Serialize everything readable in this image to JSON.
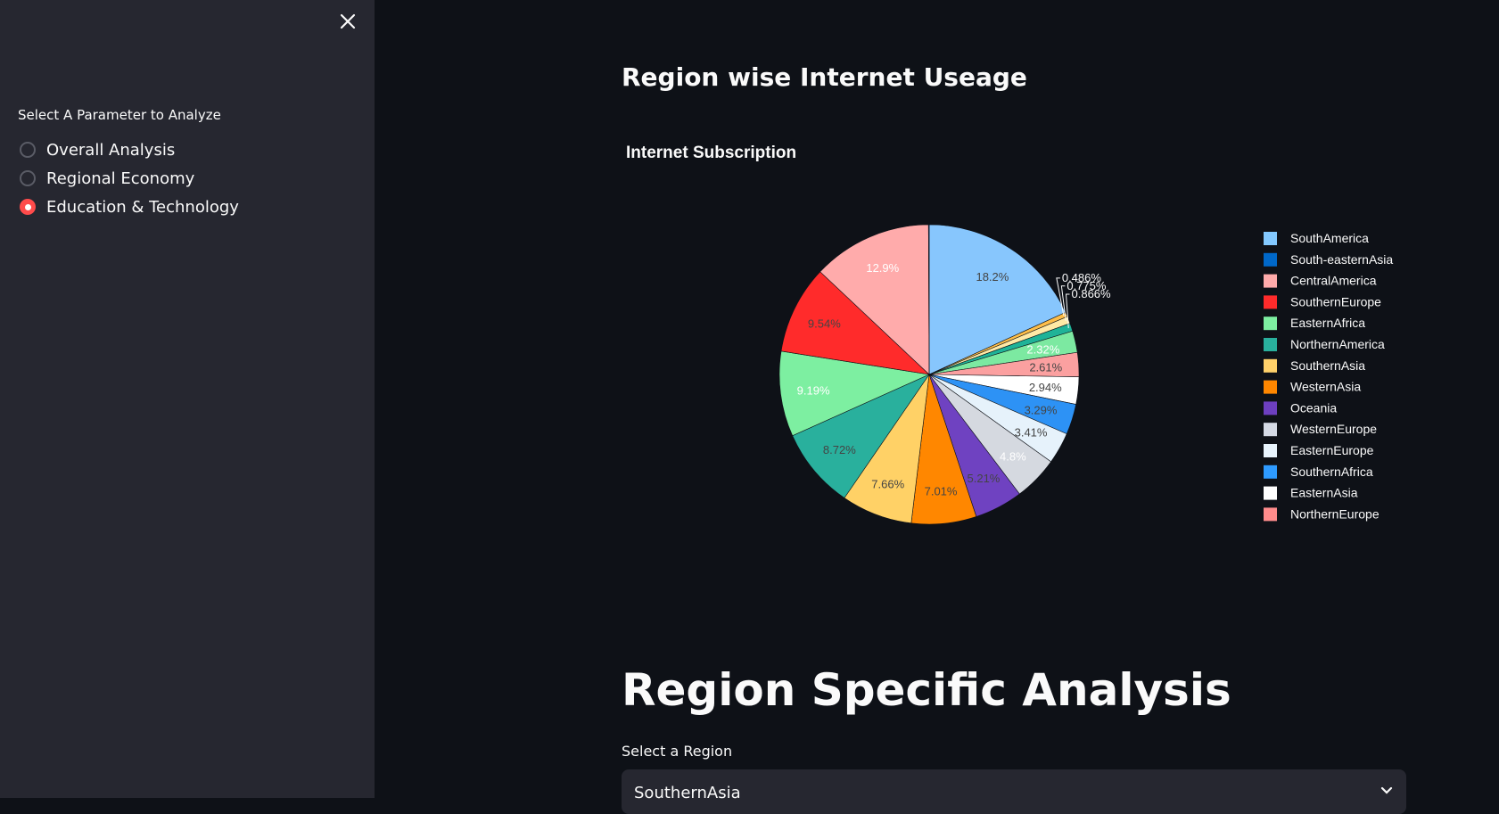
{
  "sidebar": {
    "radio_label": "Select A Parameter to Analyze",
    "options": [
      "Overall Analysis",
      "Regional Economy",
      "Education & Technology"
    ],
    "selected": "Education & Technology"
  },
  "main": {
    "section_title": "Region wise Internet Useage",
    "region_section_title": "Region Specific Analysis",
    "select_label": "Select a Region",
    "select_value": "SouthernAsia"
  },
  "chart_data": {
    "type": "pie",
    "title": "Internet Subscription",
    "legend_position": "right",
    "slices": [
      {
        "label": "SouthAmerica",
        "percent": 18.2,
        "text": "18.2%",
        "color": "#87c6fd",
        "text_color": "#444444"
      },
      {
        "label": "NorthernEurope",
        "percent": 0.486,
        "text": "0.486%",
        "color": "#fdbe4a",
        "text_color": "#ffffff"
      },
      {
        "label": "NorthernEurope",
        "percent": 0.775,
        "text": "0.775%",
        "color": "#ffe9a6",
        "text_color": "#ffffff"
      },
      {
        "label": "NorthernEurope",
        "percent": 0.866,
        "text": "0.866%",
        "color": "#1fb398",
        "text_color": "#ffffff"
      },
      {
        "label": "NorthernEurope",
        "percent": 2.32,
        "text": "2.32%",
        "color": "#7ce9a1",
        "text_color": "#ffffff"
      },
      {
        "label": "NorthernEurope",
        "percent": 2.61,
        "text": "2.61%",
        "color": "#fba0a0",
        "text_color": "#444444"
      },
      {
        "label": "EasternAsia",
        "percent": 2.94,
        "text": "2.94%",
        "color": "#ffffff",
        "text_color": "#444444"
      },
      {
        "label": "SouthernAfrica",
        "percent": 3.29,
        "text": "3.29%",
        "color": "#2d92f5",
        "text_color": "#444444"
      },
      {
        "label": "EasternEurope",
        "percent": 3.41,
        "text": "3.41%",
        "color": "#e6f2fb",
        "text_color": "#444444"
      },
      {
        "label": "WesternEurope",
        "percent": 4.8,
        "text": "4.8%",
        "color": "#d5d9e0",
        "text_color": "#ffffff"
      },
      {
        "label": "Oceania",
        "percent": 5.21,
        "text": "5.21%",
        "color": "#6f42c1",
        "text_color": "#444444"
      },
      {
        "label": "WesternAsia",
        "percent": 7.01,
        "text": "7.01%",
        "color": "#ff8700",
        "text_color": "#444444"
      },
      {
        "label": "SouthernAsia",
        "percent": 7.66,
        "text": "7.66%",
        "color": "#ffd166",
        "text_color": "#444444"
      },
      {
        "label": "NorthernAmerica",
        "percent": 8.72,
        "text": "8.72%",
        "color": "#29b09d",
        "text_color": "#444444"
      },
      {
        "label": "EasternAfrica",
        "percent": 9.19,
        "text": "9.19%",
        "color": "#7defa1",
        "text_color": "#ffffff"
      },
      {
        "label": "SouthernEurope",
        "percent": 9.54,
        "text": "9.54%",
        "color": "#ff2b2b",
        "text_color": "#444444"
      },
      {
        "label": "CentralAmerica",
        "percent": 12.9,
        "text": "12.9%",
        "color": "#ffabab",
        "text_color": "#ffffff"
      },
      {
        "label": "South-easternAsia",
        "percent": 0,
        "text": "",
        "color": "#0068c9",
        "text_color": "#ffffff"
      }
    ],
    "legend": [
      {
        "label": "SouthAmerica",
        "color": "#83c9ff"
      },
      {
        "label": "South-easternAsia",
        "color": "#0068c9"
      },
      {
        "label": "CentralAmerica",
        "color": "#ffabab"
      },
      {
        "label": "SouthernEurope",
        "color": "#ff2b2b"
      },
      {
        "label": "EasternAfrica",
        "color": "#7defa1"
      },
      {
        "label": "NorthernAmerica",
        "color": "#29b09d"
      },
      {
        "label": "SouthernAsia",
        "color": "#ffd16a"
      },
      {
        "label": "WesternAsia",
        "color": "#ff8700"
      },
      {
        "label": "Oceania",
        "color": "#6d3fc0"
      },
      {
        "label": "WesternEurope",
        "color": "#d5dae5"
      },
      {
        "label": "EasternEurope",
        "color": "#e8f4fd"
      },
      {
        "label": "SouthernAfrica",
        "color": "#2e9bff"
      },
      {
        "label": "EasternAsia",
        "color": "#ffffff"
      },
      {
        "label": "NorthernEurope",
        "color": "#ff8c8c"
      }
    ]
  }
}
